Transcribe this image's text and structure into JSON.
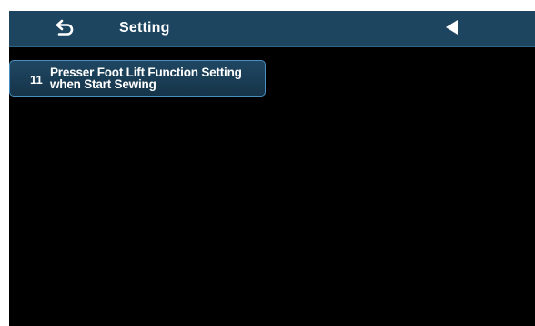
{
  "header": {
    "title": "Setting",
    "back_icon": "back-arrow-icon",
    "prev_icon": "triangle-left-icon",
    "bg_color": "#1d4560"
  },
  "items": [
    {
      "number": "11",
      "label_line1": "Presser Foot Lift Function Setting",
      "label_line2": "when Start Sewing"
    }
  ],
  "colors": {
    "screen_bg": "#000000",
    "item_border": "#4a8fbf",
    "text": "#ffffff"
  }
}
